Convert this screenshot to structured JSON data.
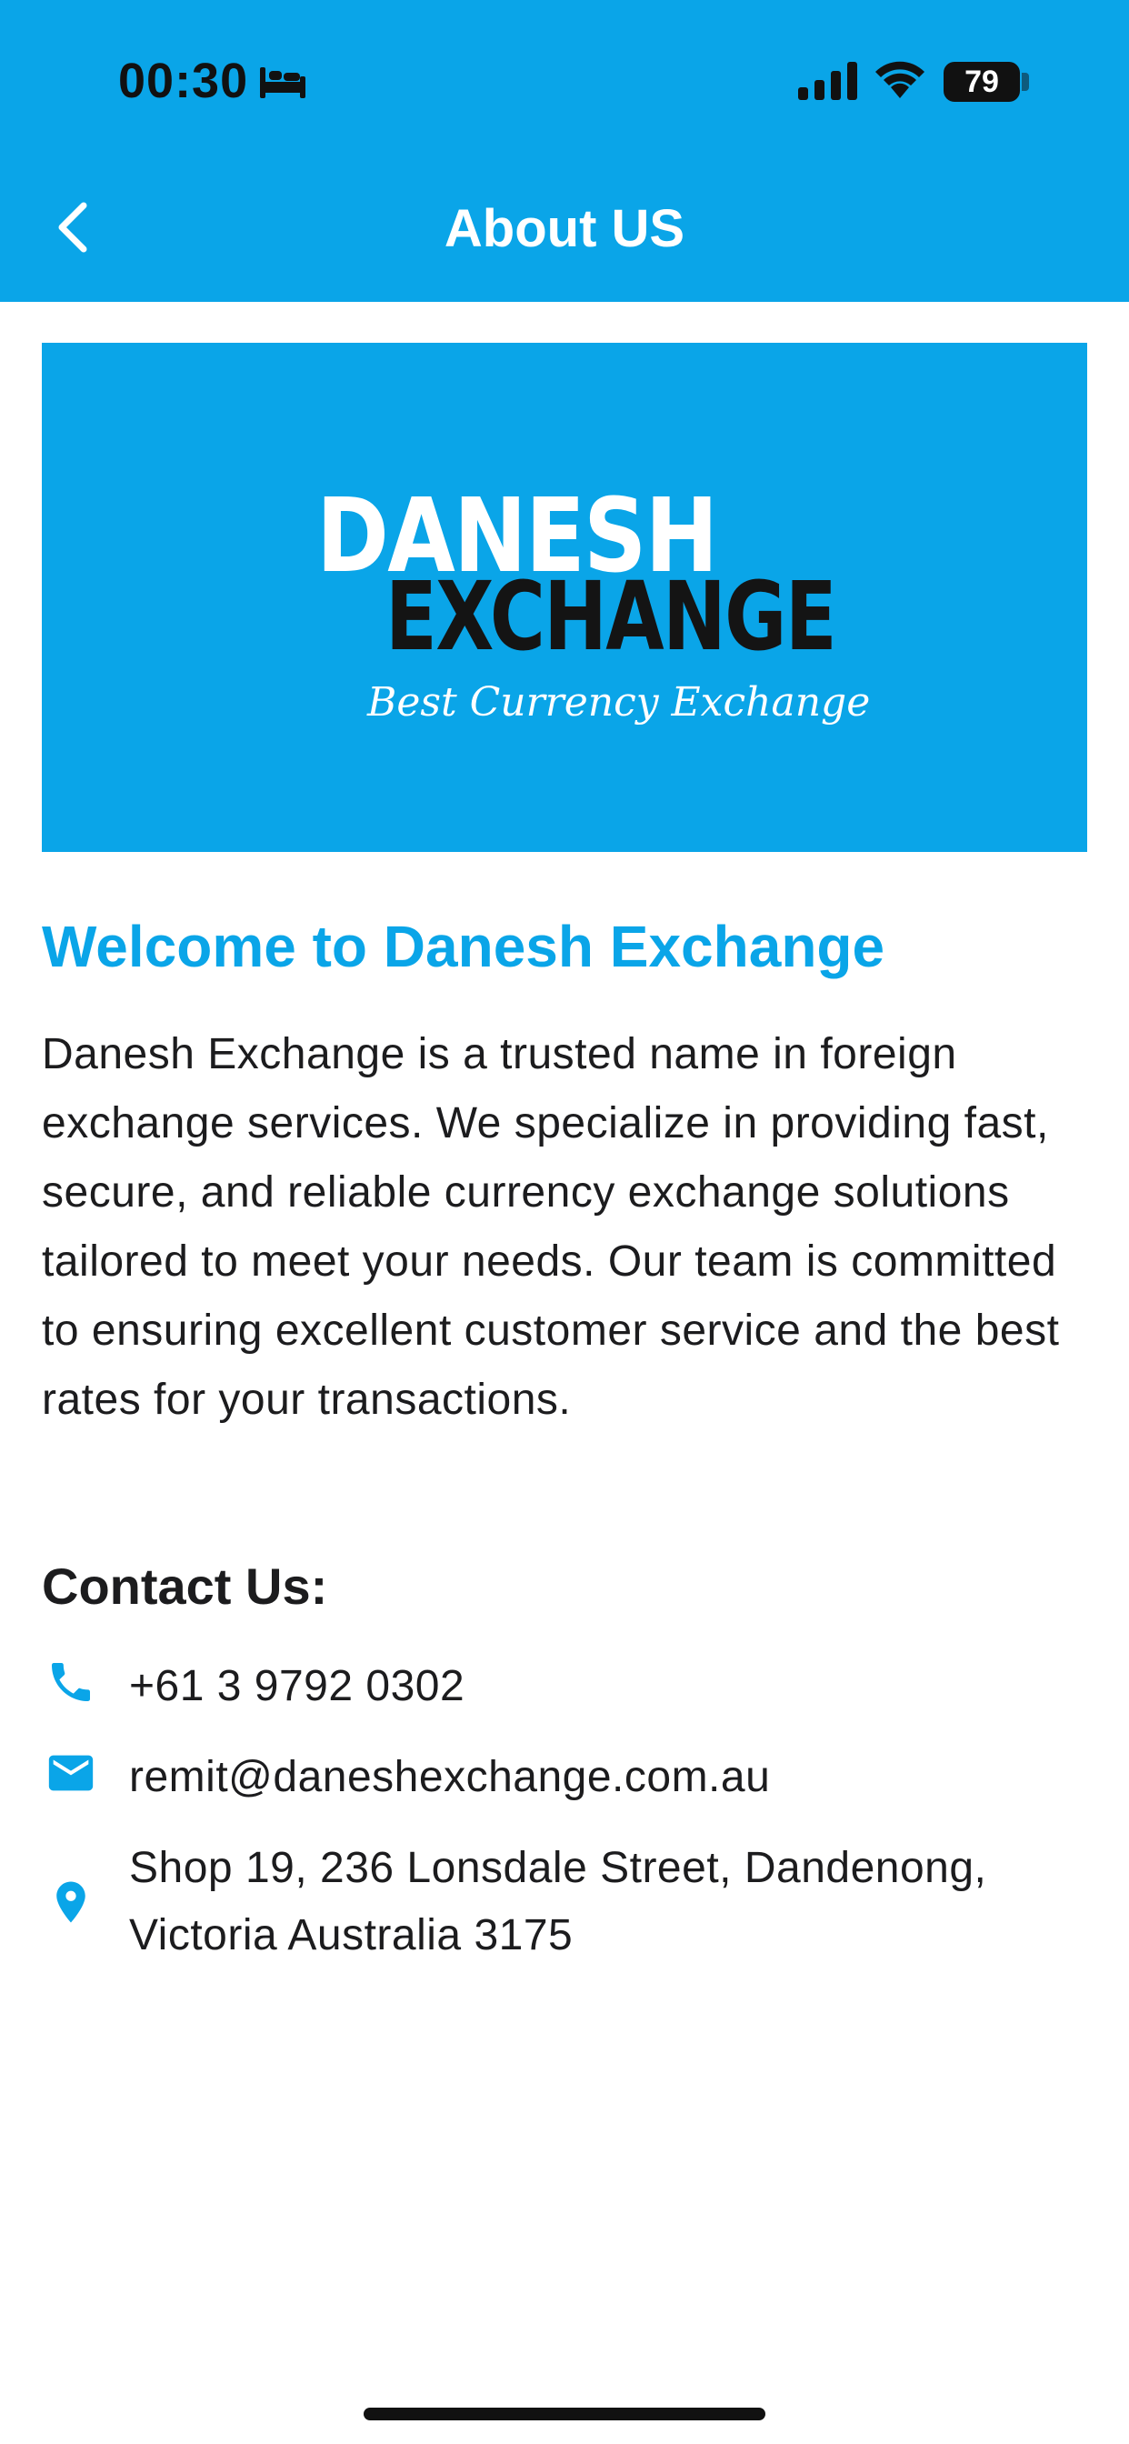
{
  "status_bar": {
    "time": "00:30",
    "battery": "79"
  },
  "nav": {
    "title": "About US",
    "back_icon": "chevron-left-icon"
  },
  "banner": {
    "logo_line1": "DANESH",
    "logo_line2": "EXCHANGE",
    "tagline": "Best Currency Exchange"
  },
  "content": {
    "welcome_heading": "Welcome to Danesh Exchange",
    "about_text": "Danesh Exchange is a trusted name in foreign exchange services. We specialize in providing fast, secure, and reliable currency exchange solutions tailored to meet your needs. Our team is committed to ensuring excellent customer service and the best rates for your transactions.",
    "contact_heading": "Contact Us:",
    "phone": "+61 3 9792 0302",
    "email": "remit@daneshexchange.com.au",
    "address": "Shop 19, 236 Lonsdale Street, Dandenong, Victoria Australia 3175"
  },
  "colors": {
    "accent": "#0aa5e8",
    "text": "#1c1c1e"
  },
  "icons": {
    "phone": "phone-icon",
    "email": "email-icon",
    "address": "location-pin-icon"
  }
}
